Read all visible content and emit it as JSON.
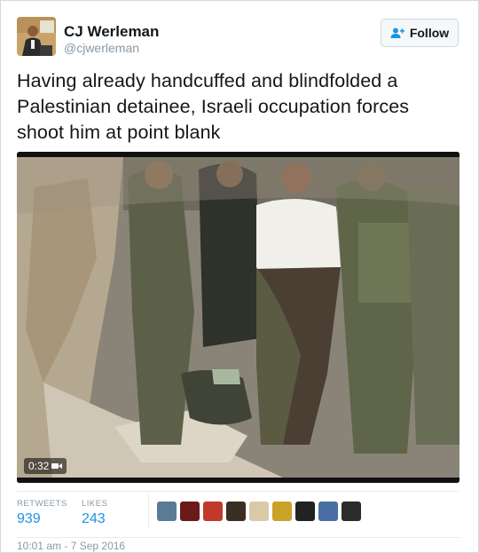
{
  "tweet": {
    "author_name": "CJ Werleman",
    "author_handle": "@cjwerleman",
    "follow_label": "Follow",
    "text": "Having already handcuffed and blindfolded a Palestinian detainee, Israeli occupation forces shoot him at point blank",
    "video_duration": "0:32",
    "timestamp": "10:01 am - 7 Sep 2016"
  },
  "stats": {
    "retweets_label": "RETWEETS",
    "retweets_value": "939",
    "likes_label": "LIKES",
    "likes_value": "243"
  },
  "likers": [
    {
      "name": "liker-avatar-1",
      "color": "#5a7a96"
    },
    {
      "name": "liker-avatar-2",
      "color": "#6b1a1a"
    },
    {
      "name": "liker-avatar-3",
      "color": "#c0392b"
    },
    {
      "name": "liker-avatar-4",
      "color": "#3b2f24"
    },
    {
      "name": "liker-avatar-5",
      "color": "#d8c9a8"
    },
    {
      "name": "liker-avatar-6",
      "color": "#c9a227"
    },
    {
      "name": "liker-avatar-7",
      "color": "#222222"
    },
    {
      "name": "liker-avatar-8",
      "color": "#4a6fa5"
    },
    {
      "name": "liker-avatar-9",
      "color": "#2b2b2b"
    }
  ],
  "icons": {
    "follow": "add-user-icon",
    "video": "video-camera-icon"
  },
  "colors": {
    "link_blue": "#1b95e0",
    "muted": "#8899a6"
  }
}
